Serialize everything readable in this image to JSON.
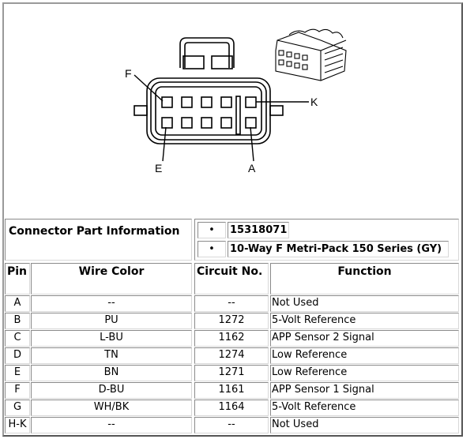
{
  "diagram": {
    "labels": {
      "F": "F",
      "K": "K",
      "E": "E",
      "A": "A"
    }
  },
  "connector_info": {
    "label": "Connector Part Information",
    "bullet": "•",
    "items": [
      "15318071",
      "10-Way F Metri-Pack 150 Series (GY)"
    ]
  },
  "table": {
    "headers": {
      "pin": "Pin",
      "wire_color": "Wire Color",
      "circuit": "Circuit No.",
      "function": "Function"
    },
    "rows": [
      {
        "pin": "A",
        "wire_color": "--",
        "circuit": "--",
        "function": "Not Used"
      },
      {
        "pin": "B",
        "wire_color": "PU",
        "circuit": "1272",
        "function": "5-Volt Reference"
      },
      {
        "pin": "C",
        "wire_color": "L-BU",
        "circuit": "1162",
        "function": "APP Sensor 2 Signal"
      },
      {
        "pin": "D",
        "wire_color": "TN",
        "circuit": "1274",
        "function": "Low Reference"
      },
      {
        "pin": "E",
        "wire_color": "BN",
        "circuit": "1271",
        "function": "Low Reference"
      },
      {
        "pin": "F",
        "wire_color": "D-BU",
        "circuit": "1161",
        "function": "APP Sensor 1 Signal"
      },
      {
        "pin": "G",
        "wire_color": "WH/BK",
        "circuit": "1164",
        "function": "5-Volt Reference"
      },
      {
        "pin": "H-K",
        "wire_color": "--",
        "circuit": "--",
        "function": "Not Used"
      }
    ]
  }
}
